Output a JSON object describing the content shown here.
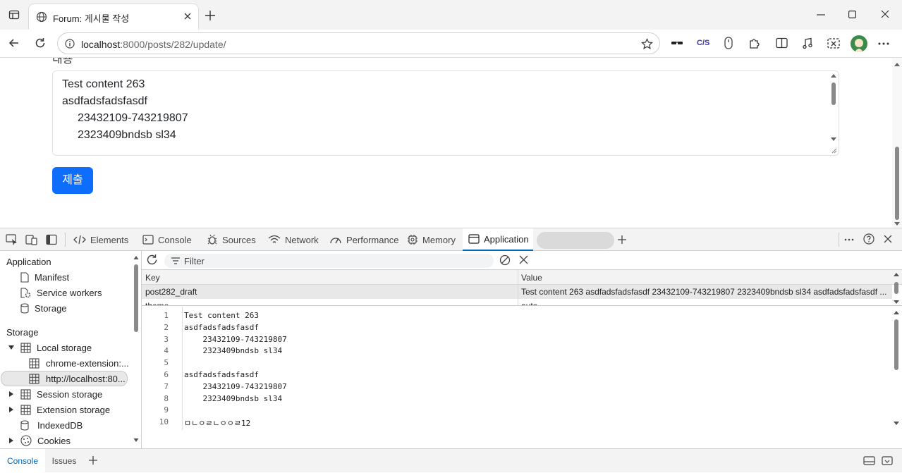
{
  "browser": {
    "tab_title": "Forum: 게시물 작성",
    "url_host": "localhost",
    "url_path": ":8000/posts/282/update/"
  },
  "page": {
    "partial_label": "내용",
    "textarea_lines": [
      "Test content 263",
      "asdfadsfadsfasdf",
      "23432109-743219807",
      "2323409bndsb sl34"
    ],
    "submit_label": "제출"
  },
  "devtools": {
    "tabs": [
      "Elements",
      "Console",
      "Sources",
      "Network",
      "Performance",
      "Memory",
      "Application"
    ],
    "active_tab": "Application",
    "sidebar": {
      "application_heading": "Application",
      "application_items": [
        "Manifest",
        "Service workers",
        "Storage"
      ],
      "storage_heading": "Storage",
      "local_storage": "Local storage",
      "local_storage_children": [
        "chrome-extension:...",
        "http://localhost:80..."
      ],
      "other_items": [
        "Session storage",
        "Extension storage",
        "IndexedDB",
        "Cookies"
      ]
    },
    "filter_placeholder": "Filter",
    "table": {
      "headers": [
        "Key",
        "Value"
      ],
      "rows": [
        {
          "key": "post282_draft",
          "value": "Test content 263 asdfadsfadsfasdf 23432109-743219807 2323409bndsb sl34 asdfadsfadsfasdf ..."
        },
        {
          "key": "theme",
          "value": "auto"
        }
      ]
    },
    "preview_lines": [
      {
        "n": "1",
        "text": "Test content 263"
      },
      {
        "n": "2",
        "text": "asdfadsfadsfasdf"
      },
      {
        "n": "3",
        "text": "    23432109-743219807"
      },
      {
        "n": "4",
        "text": "    2323409bndsb sl34"
      },
      {
        "n": "5",
        "text": ""
      },
      {
        "n": "6",
        "text": "asdfadsfadsfasdf"
      },
      {
        "n": "7",
        "text": "    23432109-743219807"
      },
      {
        "n": "8",
        "text": "    2323409bndsb sl34"
      },
      {
        "n": "9",
        "text": ""
      },
      {
        "n": "10",
        "text": "ㅁㄴㅇㄹㄴㅇㅇㄹ12"
      }
    ],
    "drawer_tabs": [
      "Console",
      "Issues"
    ]
  },
  "colors": {
    "accent": "#0067c0",
    "submit": "#0d6efd"
  }
}
